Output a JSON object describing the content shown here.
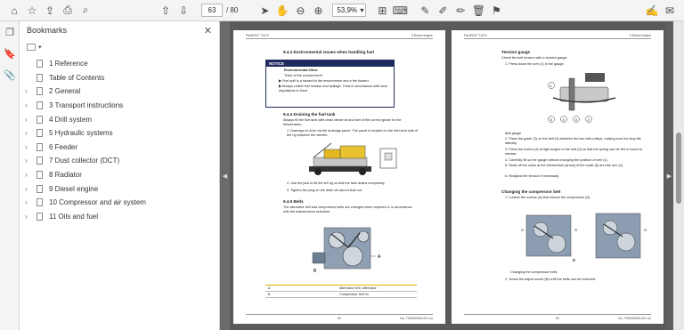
{
  "toolbar": {
    "current_page": "63",
    "total_pages": "/ 80",
    "zoom": "53,9%"
  },
  "sidebar": {
    "title": "Bookmarks",
    "items": [
      {
        "label": "1 Reference",
        "has_children": false
      },
      {
        "label": "Table of Contents",
        "has_children": false
      },
      {
        "label": "2 General",
        "has_children": true
      },
      {
        "label": "3 Transport instructions",
        "has_children": true
      },
      {
        "label": "4 Drill system",
        "has_children": true
      },
      {
        "label": "5 Hydraulic systems",
        "has_children": true
      },
      {
        "label": "6 Feeder",
        "has_children": true
      },
      {
        "label": "7 Dust collector (DCT)",
        "has_children": true
      },
      {
        "label": "8 Radiator",
        "has_children": true
      },
      {
        "label": "9 Diesel engine",
        "has_children": true
      },
      {
        "label": "10 Compressor and air system",
        "has_children": true
      },
      {
        "label": "11 Oils and fuel",
        "has_children": true
      }
    ]
  },
  "left_page": {
    "header_left": "FlexiROC T15 R",
    "header_right": "9 Diesel engine",
    "s1_title": "9.4.3 Environmental issues when handling fuel",
    "notice_label": "NOTICE",
    "notice_sub": "Environmental effect",
    "notice_line1": "Think of the environment!",
    "notice_b1": "Fuel spill is a hazard to the environment and a fire hazard.",
    "notice_b2": "Always collect fuel residue and spillage. Treat in accordance with local regulations in force.",
    "s2_title": "9.4.4 Draining the fuel tank",
    "s2_intro": "Always fill the fuel tank with clean diesel oil and fuel of the correct grade for the temperature.",
    "s2_step1": "1. Drainage is done via the drainage panel. The panel is located on the left-hand side of the rig between the wheels.",
    "s2_step2": "2. Use the jack to tilt the left rig so that the tank drains completely.",
    "s2_step3": "3. Tighten the plug on the drain oil cannot leak out.",
    "s3_title": "9.4.5 Belts",
    "s3_intro": "The alternator belt and compressor belts are changed when required or in accordance with the maintenance schedule.",
    "table": [
      [
        "A",
        "Alternator belt, alternator"
      ],
      [
        "B",
        "Compressor belt 2x"
      ]
    ],
    "footer_num": "50",
    "footer_right": "No: T0S0000S0-001 en"
  },
  "right_page": {
    "header_left": "FlexiROC T15 R",
    "header_right": "9 Diesel engine",
    "tg_title": "Tension gauge",
    "tg_intro": "Check the belt tension with a tension gauge.",
    "tg_step1": "1. Press down the arm (1) in the gauge.",
    "fig_caption": "Belt gauge",
    "tg_step2": "2. Place the guide (2) on the belt (3) between the two belt pulleys, making sure the stop fits laterally.",
    "tg_step3": "3. Press the button (4) at right angles to the belt (3) so that the spring can be felt or heard to release.",
    "tg_step4": "4. Carefully lift up the gauge without changing the position of arm (1).",
    "tg_step5": "5. Read off the value at the intersection (arrow) of the scale (5) and the arm (1).",
    "tg_step6": "6. Readjust the tension if necessary.",
    "cb_title": "Changing the compressor belt",
    "cb_step1": "1. Loosen the screws (A) that secure the compressor (A).",
    "cb_caption": "Changing the compressor belts",
    "cb_step2": "2. Screw the adjust screw (B) until the belts can be removed.",
    "footer_num": "50",
    "footer_right": "No: T0S0000S0-001 en"
  }
}
